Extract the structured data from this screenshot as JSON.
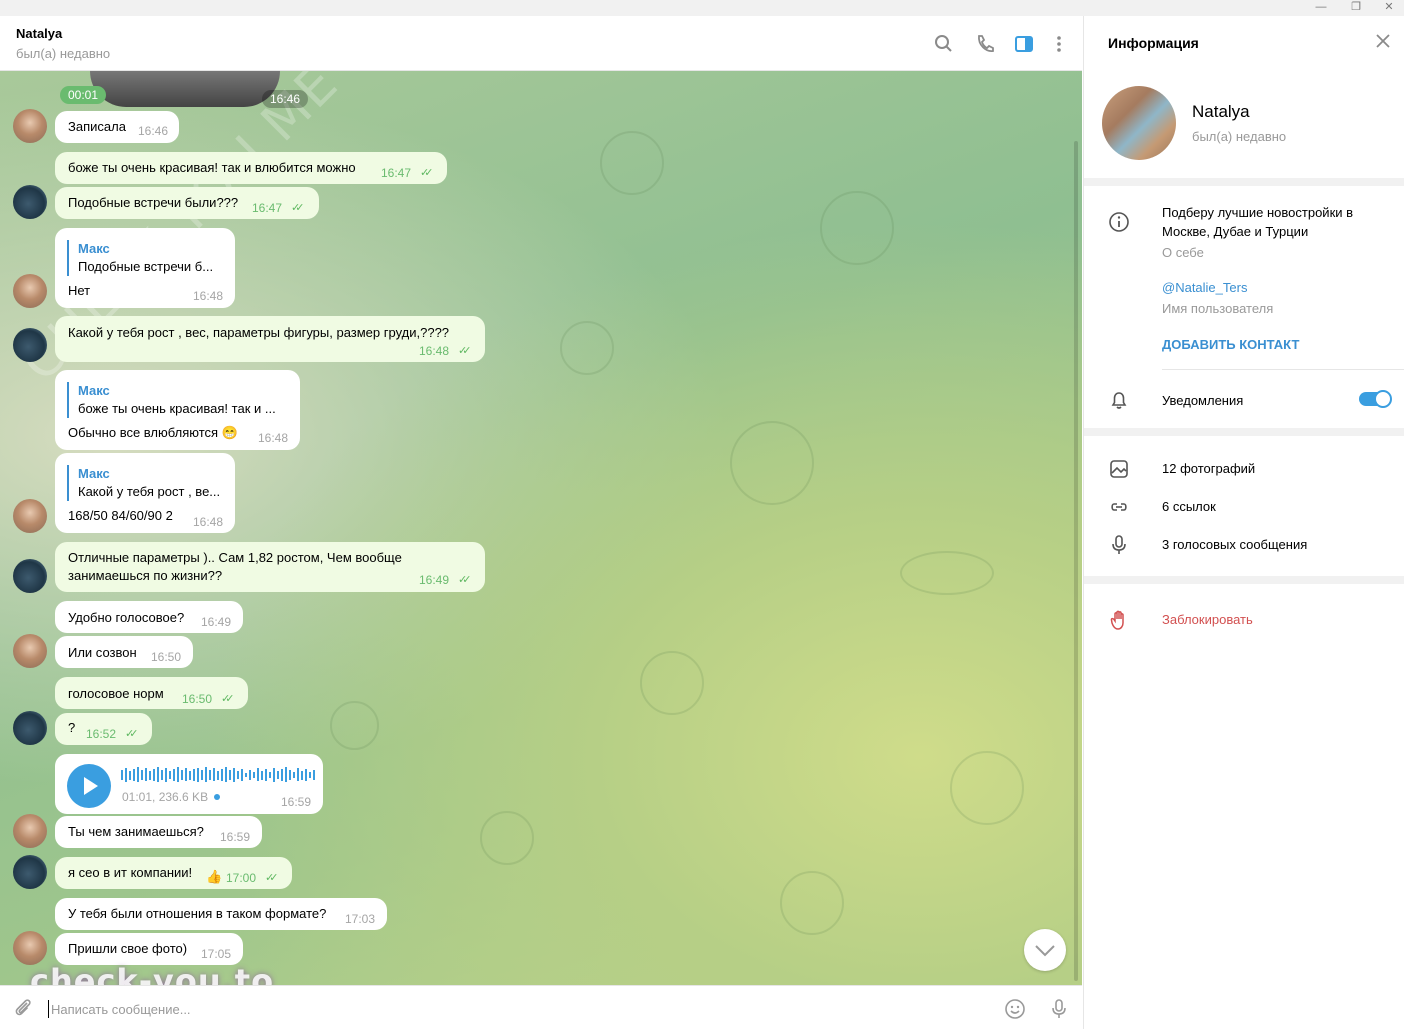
{
  "window": {
    "minimize": "—",
    "restore": "❐",
    "close": "✕"
  },
  "header": {
    "name": "Natalya",
    "status": "был(а) недавно",
    "icons": [
      "search-icon",
      "phone-icon",
      "sidebar-toggle-icon",
      "more-icon"
    ]
  },
  "top_media": {
    "duration": "00:01",
    "time": "16:46"
  },
  "messages": [
    {
      "dir": "in",
      "text": "Записала",
      "time": "16:46"
    },
    {
      "dir": "out",
      "text": "боже ты очень красивая! так и влюбится можно",
      "time": "16:47",
      "check": "✓✓"
    },
    {
      "dir": "out",
      "text": "Подобные встречи были???",
      "time": "16:47",
      "check": "✓✓"
    },
    {
      "dir": "in",
      "reply_name": "Макс",
      "reply_text": "Подобные встречи б...",
      "text": "Нет",
      "time": "16:48"
    },
    {
      "dir": "out",
      "text": "Какой у тебя рост , вес, параметры фигуры, размер груди,????",
      "time": "16:48",
      "check": "✓✓"
    },
    {
      "dir": "in",
      "reply_name": "Макс",
      "reply_text": "боже ты очень красивая! так и ...",
      "text": "Обычно все влюбляются 😁",
      "time": "16:48"
    },
    {
      "dir": "in",
      "reply_name": "Макс",
      "reply_text": "Какой у тебя рост , ве...",
      "text": "168/50 84/60/90 2",
      "time": "16:48"
    },
    {
      "dir": "out",
      "text_line1": "Отличные параметры ).. Сам 1,82 ростом, Чем вообще",
      "text_line2": "занимаешься по жизни??",
      "time": "16:49",
      "check": "✓✓"
    },
    {
      "dir": "in",
      "text": "Удобно голосовое?",
      "time": "16:49"
    },
    {
      "dir": "in",
      "text": "Или созвон",
      "time": "16:50"
    },
    {
      "dir": "out",
      "text": "голосовое норм",
      "time": "16:50",
      "check": "✓✓"
    },
    {
      "dir": "out",
      "text": "?",
      "time": "16:52",
      "check": "✓✓"
    },
    {
      "dir": "in",
      "voice_meta": "01:01, 236.6 KB",
      "time": "16:59"
    },
    {
      "dir": "in",
      "text": "Ты чем занимаешься?",
      "time": "16:59"
    },
    {
      "dir": "out",
      "text": "я сео в ит компании!",
      "reaction": "👍",
      "time": "17:00",
      "check": "✓✓"
    },
    {
      "dir": "in",
      "text": "У тебя были отношения в таком формате?",
      "time": "17:03"
    },
    {
      "dir": "in",
      "text": "Пришли свое фото)",
      "time": "17:05"
    }
  ],
  "composer": {
    "placeholder": "Написать сообщение...",
    "icons": [
      "attach-icon",
      "emoji-icon",
      "mic-icon"
    ]
  },
  "watermark": {
    "main": "check-you.to",
    "diagonal": "CHECK YOU ME"
  },
  "panel": {
    "title": "Информация",
    "name": "Natalya",
    "status": "был(а) недавно",
    "bio_line1": "Подберу лучшие новостройки в",
    "bio_line2": "Москве, Дубае и Турции",
    "bio_label": "О себе",
    "username": "@Natalie_Ters",
    "username_label": "Имя пользователя",
    "add_contact": "ДОБАВИТЬ КОНТАКТ",
    "notifications": "Уведомления",
    "notifications_on": true,
    "photos": "12 фотографий",
    "links": "6 ссылок",
    "voice": "3 голосовых сообщения",
    "block": "Заблокировать"
  },
  "colors": {
    "accent": "#3a9ee0",
    "outgoing_bubble": "#f0fbe3",
    "check_green": "#5fb861",
    "danger": "#d25050"
  }
}
